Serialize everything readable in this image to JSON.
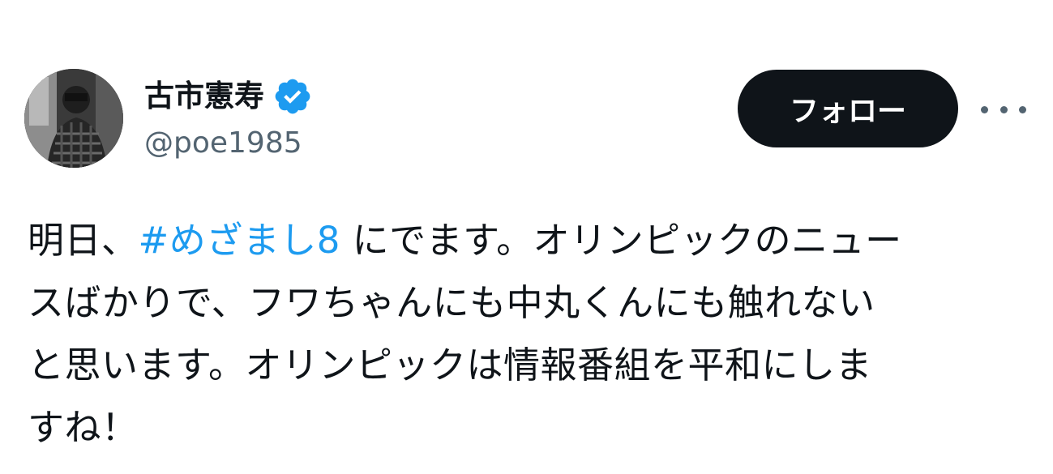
{
  "user": {
    "display_name": "古市憲寿",
    "handle": "@poe1985",
    "verified": true,
    "avatar_icon": "profile-photo-grayscale"
  },
  "actions": {
    "follow_label": "フォロー",
    "more_icon": "more-horizontal-icon"
  },
  "tweet": {
    "line1_before": "明日、",
    "hashtag": "#めざまし8",
    "line1_after": " にでます。オリンピックのニュー",
    "line2": "スばかりで、フワちゃんにも中丸くんにも触れない",
    "line3": "と思います。オリンピックは情報番組を平和にしま",
    "line4": "すね！"
  },
  "colors": {
    "text": "#0f1419",
    "secondary": "#536471",
    "link": "#1d9bf0",
    "follow_bg": "#0f1419",
    "follow_text": "#ffffff",
    "verified": "#1d9bf0"
  }
}
